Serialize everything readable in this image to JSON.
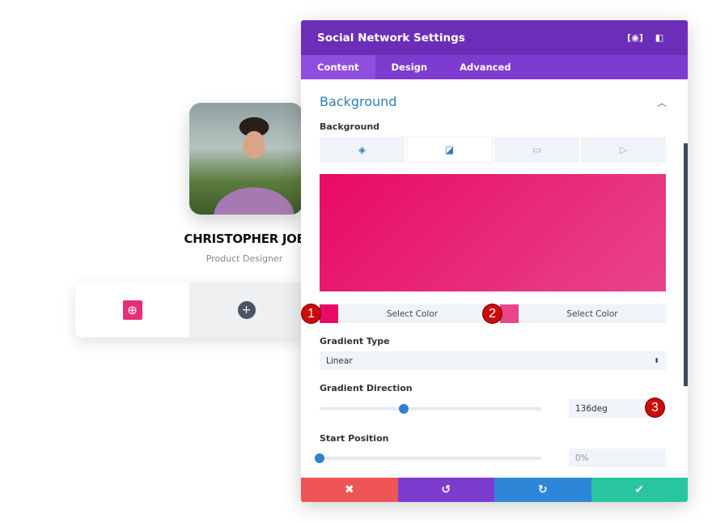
{
  "profile": {
    "name": "CHRISTOPHER JOE",
    "role": "Product Designer"
  },
  "social": {
    "network_icon": "dribbble-icon",
    "add_icon": "plus-icon"
  },
  "panel": {
    "title": "Social Network Settings",
    "tabs": [
      {
        "label": "Content",
        "active": true
      },
      {
        "label": "Design"
      },
      {
        "label": "Advanced"
      }
    ],
    "section": "Background",
    "background_label": "Background",
    "bg_types": [
      "color",
      "gradient",
      "image",
      "video"
    ],
    "gradient": {
      "color1": "#e80a64",
      "color2": "#e8458a",
      "select1": "Select Color",
      "select2": "Select Color"
    },
    "gradient_type_label": "Gradient Type",
    "gradient_type": "Linear",
    "direction_label": "Gradient Direction",
    "direction": "136deg",
    "direction_fraction": 0.378,
    "start_label": "Start Position",
    "start": "0%",
    "start_fraction": 0,
    "badges": [
      "1",
      "2",
      "3"
    ],
    "footer": {
      "cancel": "✖",
      "undo": "↺",
      "redo": "↻",
      "save": "✔"
    },
    "colors": {
      "header": "#6c2eb9",
      "tabs": "#7e3bd0",
      "cancel": "#ef5555",
      "undo": "#7e3bd0",
      "redo": "#2e86d8",
      "save": "#29c4a0"
    }
  }
}
